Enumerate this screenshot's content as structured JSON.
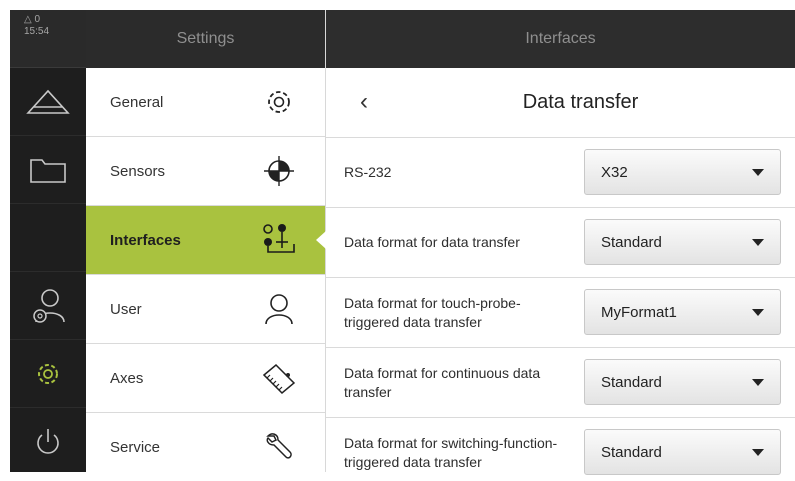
{
  "status": {
    "warnings": "0",
    "time": "15:54"
  },
  "rail": {
    "items": [
      {
        "icon": "measure-icon"
      },
      {
        "icon": "folder-icon"
      },
      {
        "icon": "empty"
      },
      {
        "icon": "user-settings-icon"
      },
      {
        "icon": "gear-icon"
      },
      {
        "icon": "power-icon"
      }
    ]
  },
  "settings": {
    "header": "Settings",
    "items": [
      {
        "label": "General",
        "icon": "gear-icon"
      },
      {
        "label": "Sensors",
        "icon": "crosshair-icon"
      },
      {
        "label": "Interfaces",
        "icon": "interfaces-icon",
        "active": true
      },
      {
        "label": "User",
        "icon": "user-icon"
      },
      {
        "label": "Axes",
        "icon": "scale-icon"
      },
      {
        "label": "Service",
        "icon": "wrench-icon"
      }
    ]
  },
  "panel": {
    "header": "Interfaces",
    "title": "Data transfer",
    "back": "‹",
    "rows": [
      {
        "label": "RS-232",
        "value": "X32"
      },
      {
        "label": "Data format for data transfer",
        "value": "Standard"
      },
      {
        "label": "Data format for touch-probe-triggered data transfer",
        "value": "MyFormat1"
      },
      {
        "label": "Data format for continuous data transfer",
        "value": "Standard"
      },
      {
        "label": "Data format for switching-function-triggered data transfer",
        "value": "Standard"
      }
    ]
  },
  "colors": {
    "accent": "#a9c23f",
    "rail": "#1e1e1e",
    "header": "#2b2b2b"
  }
}
